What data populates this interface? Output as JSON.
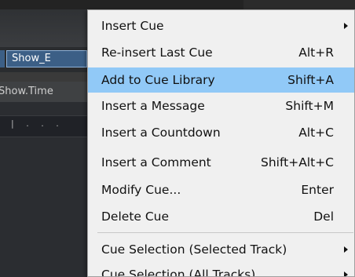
{
  "background": {
    "field_value": "Show_E",
    "showtime_label": "Show.Time",
    "ruler_marks": "| . . ."
  },
  "menu": {
    "items": [
      {
        "label": "Insert Cue",
        "shortcut": "",
        "submenu": true
      },
      {
        "label": "Re-insert Last Cue",
        "shortcut": "Alt+R",
        "submenu": false
      },
      {
        "label": "Add to Cue Library",
        "shortcut": "Shift+A",
        "submenu": false,
        "highlighted": true
      },
      {
        "label": "Insert a Message",
        "shortcut": "Shift+M",
        "submenu": false
      },
      {
        "label": "Insert a Countdown",
        "shortcut": "Alt+C",
        "submenu": false
      },
      {
        "label": "Insert a Comment",
        "shortcut": "Shift+Alt+C",
        "submenu": false
      },
      {
        "label": "Modify Cue...",
        "shortcut": "Enter",
        "submenu": false
      },
      {
        "label": "Delete Cue",
        "shortcut": "Del",
        "submenu": false
      },
      {
        "label": "Cue Selection (Selected Track)",
        "shortcut": "",
        "submenu": true
      },
      {
        "label": "Cue Selection (All Tracks)",
        "shortcut": "",
        "submenu": true
      }
    ]
  },
  "colors": {
    "menu_background": "#f0f0f0",
    "highlight": "#91c9f7",
    "field_background": "#3c5f86"
  }
}
